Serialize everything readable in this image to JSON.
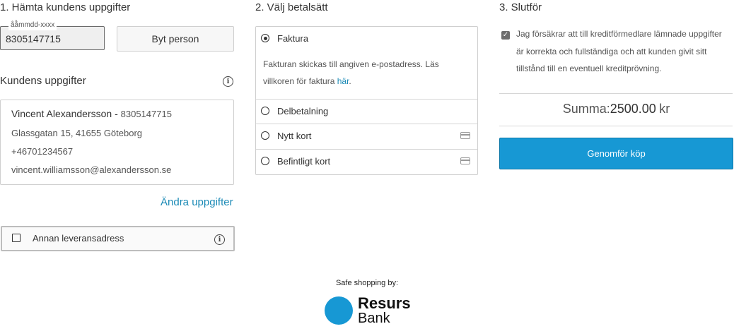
{
  "step1": {
    "heading": "1. Hämta kundens uppgifter",
    "personnummer_legend": "åå̊mmdd-xxxx",
    "personnummer_value": "8305147715",
    "change_person_button": "Byt person",
    "customer_heading": "Kundens uppgifter",
    "customer": {
      "name": "Vincent Alexandersson",
      "separator": " - ",
      "personnummer": "8305147715",
      "address": "Glassgatan 15, 41655 Göteborg",
      "phone": "+46701234567",
      "email": "vincent.williamsson@alexandersson.se"
    },
    "edit_link": "Ändra uppgifter",
    "alt_delivery_label": "Annan leveransadress"
  },
  "step2": {
    "heading": "2. Välj betalsätt",
    "options": [
      {
        "label": "Faktura",
        "selected": true
      },
      {
        "label": "Delbetalning",
        "selected": false
      },
      {
        "label": "Nytt kort",
        "selected": false,
        "icon": "credit-card-icon"
      },
      {
        "label": "Befintligt kort",
        "selected": false,
        "icon": "credit-card-icon"
      }
    ],
    "invoice_desc_1": "Fakturan skickas till angiven e-postadress. Läs",
    "invoice_desc_2": "villkoren för faktura ",
    "invoice_link": "här",
    "invoice_desc_end": "."
  },
  "step3": {
    "heading": "3. Slutför",
    "terms_line1": "Jag försäkrar att till kreditförmedlare lämnade uppgifter",
    "terms_line2": "är korrekta och fullständiga och att kunden givit sitt",
    "terms_line3": "tillstånd till en eventuell kreditprövning.",
    "terms_checked": true,
    "sum_label": "Summa:",
    "sum_value": "2500.00",
    "currency": "kr",
    "submit_button": "Genomför köp"
  },
  "footer": {
    "safe_shopping": "Safe shopping by:",
    "logo_line1": "Resurs",
    "logo_line2": "Bank"
  },
  "colors": {
    "accent": "#1798d4",
    "link": "#1b8ab6"
  }
}
